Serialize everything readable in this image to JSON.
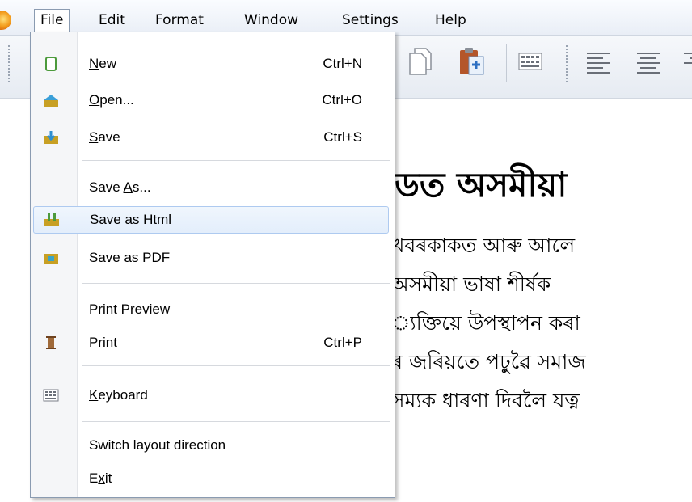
{
  "menubar": {
    "items": [
      {
        "label": "File",
        "active": true
      },
      {
        "label": "Edit"
      },
      {
        "label": "Format"
      },
      {
        "label": "Window"
      },
      {
        "label": "Settings"
      },
      {
        "label": "Help"
      }
    ]
  },
  "file_menu": {
    "new": {
      "label": "New",
      "shortcut": "Ctrl+N"
    },
    "open": {
      "label": "Open...",
      "shortcut": "Ctrl+O"
    },
    "save": {
      "label": "Save",
      "shortcut": "Ctrl+S"
    },
    "save_as": {
      "label": "Save As..."
    },
    "save_as_html": {
      "label": "Save as Html",
      "highlighted": true
    },
    "save_as_pdf": {
      "label": "Save as PDF"
    },
    "print_preview": {
      "label": "Print Preview"
    },
    "print": {
      "label": "Print",
      "shortcut": "Ctrl+P"
    },
    "keyboard": {
      "label": "Keyboard"
    },
    "switch_layout": {
      "label": "Switch layout direction"
    },
    "exit": {
      "label": "Exit"
    }
  },
  "document": {
    "heading": "ডত অসমীয়া",
    "lines": [
      "খবৰকাকত আৰু আলে",
      "অসমীয়া ভাষা শীৰ্ষক",
      "্যক্তিয়ে উপস্থাপন কৰা",
      "ৰ জৰিয়তে পঢ়ুৱৈ সমাজ",
      "সম্যক ধাৰণা দিবলৈ যত্ন"
    ]
  },
  "colors": {
    "highlight_border": "#aecaf0",
    "highlight_fill": "#e3eefb",
    "menu_border": "#8a9bb1"
  }
}
